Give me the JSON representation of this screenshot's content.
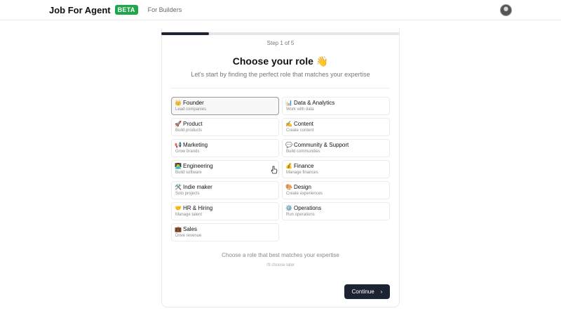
{
  "header": {
    "brand": "Job For Agent",
    "badge": "BETA",
    "nav_link": "For Builders"
  },
  "progress": {
    "step_text": "Step 1 of 5",
    "fraction": 0.2
  },
  "main": {
    "title": "Choose your role 👋",
    "subtitle": "Let's start by finding the perfect role that matches your expertise",
    "roles_left": [
      {
        "icon": "👑",
        "title": "Founder",
        "subtitle": "Lead companies",
        "selected": true
      },
      {
        "icon": "🚀",
        "title": "Product",
        "subtitle": "Build products"
      },
      {
        "icon": "📢",
        "title": "Marketing",
        "subtitle": "Grow brands"
      },
      {
        "icon": "👨‍💻",
        "title": "Engineering",
        "subtitle": "Build software"
      },
      {
        "icon": "🛠️",
        "title": "Indie maker",
        "subtitle": "Solo projects"
      },
      {
        "icon": "🤝",
        "title": "HR & Hiring",
        "subtitle": "Manage talent"
      },
      {
        "icon": "💼",
        "title": "Sales",
        "subtitle": "Drive revenue"
      }
    ],
    "roles_right": [
      {
        "icon": "📊",
        "title": "Data & Analytics",
        "subtitle": "Work with data"
      },
      {
        "icon": "✍️",
        "title": "Content",
        "subtitle": "Create content"
      },
      {
        "icon": "💬",
        "title": "Community & Support",
        "subtitle": "Build communities"
      },
      {
        "icon": "💰",
        "title": "Finance",
        "subtitle": "Manage finances"
      },
      {
        "icon": "🎨",
        "title": "Design",
        "subtitle": "Create experiences"
      },
      {
        "icon": "⚙️",
        "title": "Operations",
        "subtitle": "Run operations"
      }
    ],
    "hint": "Choose a role that best matches your expertise",
    "later_link": "I'll choose later",
    "continue_label": "Continue",
    "continue_chevron": "›"
  }
}
